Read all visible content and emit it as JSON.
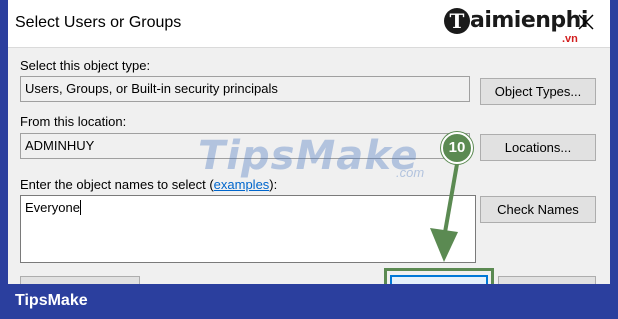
{
  "window": {
    "title": "Select Users or Groups"
  },
  "branding": {
    "logo_initial": "T",
    "logo_name": "aimienphi",
    "logo_tld": ".vn",
    "watermark": "TipsMake",
    "watermark_suffix": ".com",
    "footer_text": "TipsMake"
  },
  "object_type": {
    "label": "Select this object type:",
    "value": "Users, Groups, or Built-in security principals",
    "button_label": "Object Types..."
  },
  "location": {
    "label": "From this location:",
    "value": "ADMINHUY",
    "button_label": "Locations..."
  },
  "object_names": {
    "label_prefix": "Enter the object names to select (",
    "label_link": "examples",
    "label_suffix": "):",
    "value": "Everyone",
    "button_label": "Check Names"
  },
  "annotation": {
    "step_number": "10",
    "color": "#5b8a52"
  },
  "colors": {
    "frame": "#2b3f9e",
    "focus": "#0078d7",
    "link": "#0066cc"
  }
}
